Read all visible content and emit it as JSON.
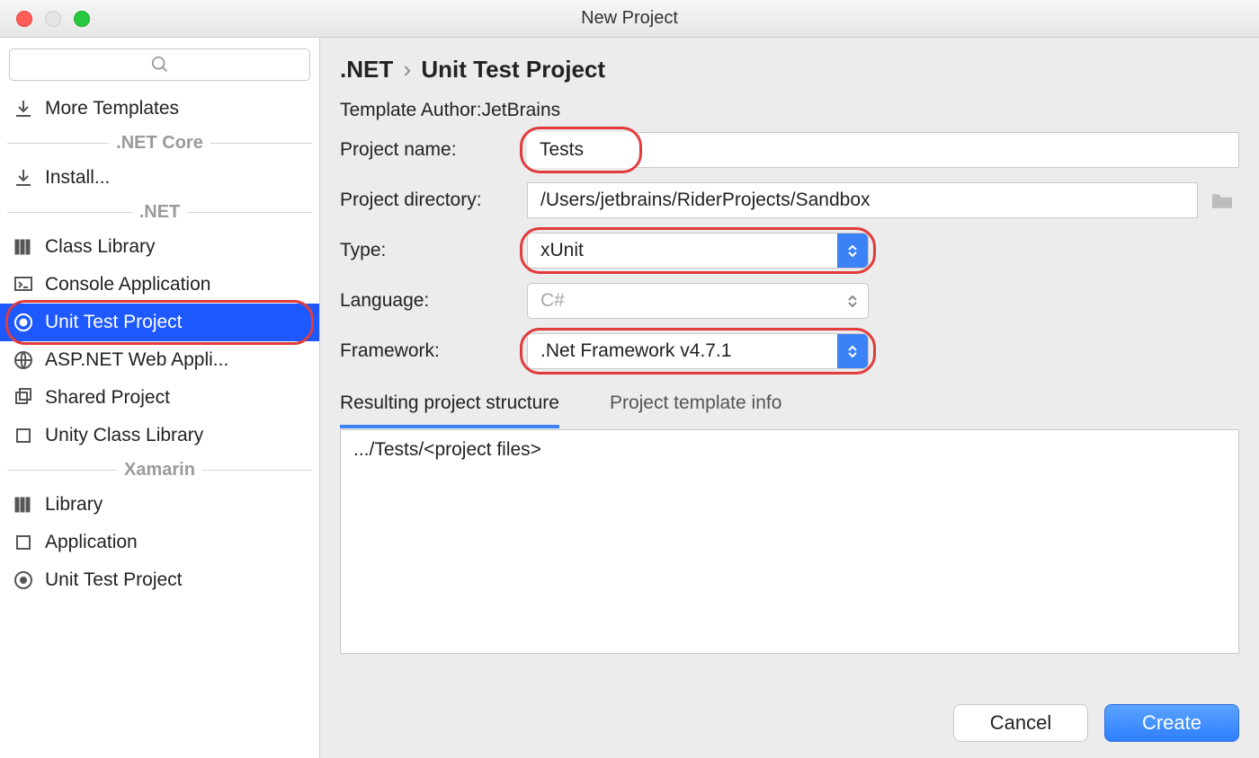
{
  "window": {
    "title": "New Project"
  },
  "sidebar": {
    "more_templates": "More Templates",
    "install": "Install...",
    "groups": {
      "dotnet_core": ".NET Core",
      "dotnet": ".NET",
      "xamarin": "Xamarin"
    },
    "items_dotnet": [
      "Class Library",
      "Console Application",
      "Unit Test Project",
      "ASP.NET Web Appli...",
      "Shared Project",
      "Unity Class Library"
    ],
    "items_xamarin": [
      "Library",
      "Application",
      "Unit Test Project"
    ]
  },
  "breadcrumb": {
    "root": ".NET",
    "leaf": "Unit Test Project"
  },
  "template_author": {
    "label": "Template Author:",
    "value": "JetBrains"
  },
  "form": {
    "project_name": {
      "label": "Project name:",
      "value": "Tests"
    },
    "project_directory": {
      "label": "Project directory:",
      "value": "/Users/jetbrains/RiderProjects/Sandbox"
    },
    "type": {
      "label": "Type:",
      "value": "xUnit"
    },
    "language": {
      "label": "Language:",
      "value": "C#"
    },
    "framework": {
      "label": "Framework:",
      "value": ".Net Framework v4.7.1"
    }
  },
  "tabs": {
    "structure": "Resulting project structure",
    "info": "Project template info"
  },
  "result_text": ".../Tests/<project files>",
  "buttons": {
    "cancel": "Cancel",
    "create": "Create"
  }
}
